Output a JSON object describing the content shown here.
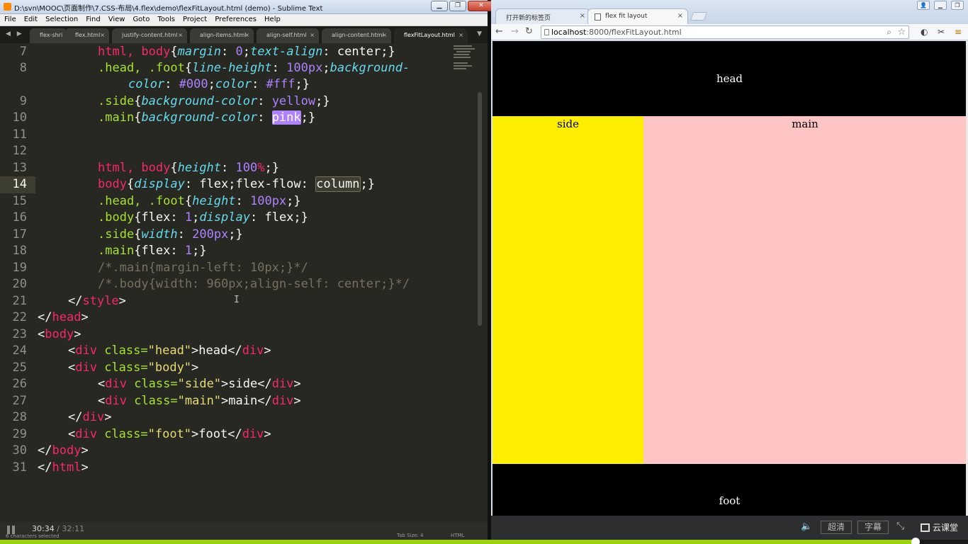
{
  "sublime": {
    "title": "D:\\svn\\MOOC\\页面制作\\7.CSS-布局\\4.flex\\demo\\flexFitLayout.html (demo) - Sublime Text",
    "menu": [
      "File",
      "Edit",
      "Selection",
      "Find",
      "View",
      "Goto",
      "Tools",
      "Project",
      "Preferences",
      "Help"
    ],
    "tab_nav": "◀ ▶",
    "tab_dropdown": "▼",
    "tabs": [
      "flex-shri",
      "flex.html",
      "justify-content.html",
      "align-items.html",
      "align-self.html",
      "align-content.html",
      "flexFitLayout.html"
    ],
    "active_tab": 6,
    "line_numbers": [
      "7",
      "8",
      "",
      "9",
      "10",
      "11",
      "12",
      "13",
      "14",
      "15",
      "16",
      "17",
      "18",
      "19",
      "20",
      "21",
      "22",
      "23",
      "24",
      "25",
      "26",
      "27",
      "28",
      "29",
      "30",
      "31"
    ],
    "current_line": "14",
    "code": {
      "l7": [
        "html, body",
        "{",
        "margin",
        ": ",
        "0",
        ";",
        "text-align",
        ": center;}"
      ],
      "l8a": [
        ".head, .foot",
        "{",
        "line-height",
        ": ",
        "100px",
        ";",
        "background-"
      ],
      "l8b": [
        "color",
        ": ",
        "#000",
        ";",
        "color",
        ": ",
        "#fff",
        ";}"
      ],
      "l9": [
        ".side",
        "{",
        "background-color",
        ": ",
        "yellow",
        ";}"
      ],
      "l10": [
        ".main",
        "{",
        "background-color",
        ": ",
        "pink",
        ";}"
      ],
      "l13": [
        "html, body",
        "{",
        "height",
        ": ",
        "100",
        "%",
        ";}"
      ],
      "l14": [
        "body",
        "{",
        "display",
        ": flex;flex-flow: ",
        "column",
        ";}"
      ],
      "l15": [
        ".head, .foot",
        "{",
        "height",
        ": ",
        "100px",
        ";}"
      ],
      "l16": [
        ".body",
        "{flex: ",
        "1",
        ";",
        "display",
        ": flex;}"
      ],
      "l17": [
        ".side",
        "{",
        "width",
        ": ",
        "200px",
        ";}"
      ],
      "l18": [
        ".main",
        "{flex: ",
        "1",
        ";}"
      ],
      "l19": "/*.main{margin-left: 10px;}*/",
      "l20": "/*.body{width: 960px;align-self: center;}*/",
      "l21": [
        "</",
        "style",
        ">"
      ],
      "l22": [
        "</",
        "head",
        ">"
      ],
      "l23": [
        "<",
        "body",
        ">"
      ],
      "l24": [
        "<",
        "div",
        " class=",
        "\"head\"",
        ">head</",
        "div",
        ">"
      ],
      "l25": [
        "<",
        "div",
        " class=",
        "\"body\"",
        ">"
      ],
      "l26": [
        "<",
        "div",
        " class=",
        "\"side\"",
        ">side</",
        "div",
        ">"
      ],
      "l27": [
        "<",
        "div",
        " class=",
        "\"main\"",
        ">main</",
        "div",
        ">"
      ],
      "l28": [
        "</",
        "div",
        ">"
      ],
      "l29": [
        "<",
        "div",
        " class=",
        "\"foot\"",
        ">foot</",
        "div",
        ">"
      ],
      "l30": [
        "</",
        "body",
        ">"
      ],
      "l31": [
        "</",
        "html",
        ">"
      ]
    },
    "status": {
      "time_current": "30:34",
      "time_total": "/ 32:11",
      "selection": "6 characters selected",
      "tab_size": "Tab Size: 4",
      "syntax": "HTML"
    }
  },
  "chrome": {
    "tabs": [
      {
        "label": "打开新的标签页",
        "close": "×"
      },
      {
        "label": "flex fit layout",
        "close": "×"
      }
    ],
    "url_host": "localhost",
    "url_path": ":8000/flexFitLayout.html",
    "page": {
      "head": "head",
      "side": "side",
      "main": "main",
      "foot": "foot"
    },
    "colors": {
      "head": "#000000",
      "side": "#ffee00",
      "main": "#ffc4c4",
      "foot": "#000000"
    }
  },
  "video": {
    "quality": "超清",
    "subtitle": "字幕",
    "brand": "云课堂",
    "progress": 0.946
  }
}
